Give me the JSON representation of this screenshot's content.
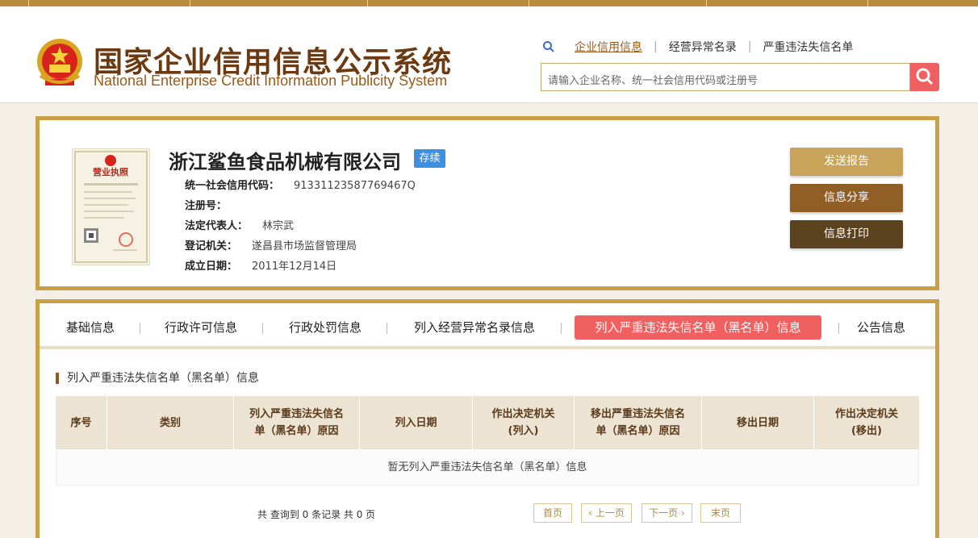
{
  "header": {
    "title_cn": "国家企业信用信息公示系统",
    "title_en": "National Enterprise Credit Information Publicity System",
    "links": [
      "企业信用信息",
      "经营异常名录",
      "严重违法失信名单"
    ],
    "search_placeholder": "请输入企业名称、统一社会信用代码或注册号",
    "icons": {
      "emblem": "national-emblem-icon",
      "magnifier": "search-icon"
    }
  },
  "company": {
    "name": "浙江鲨鱼食品机械有限公司",
    "status": "存续",
    "fields": [
      {
        "label": "统一社会信用代码：",
        "value": "91331123587769467Q"
      },
      {
        "label": "注册号：",
        "value": ""
      },
      {
        "label": "法定代表人：",
        "value": "林宗武"
      },
      {
        "label": "登记机关：",
        "value": "遂昌县市场监督管理局"
      },
      {
        "label": "成立日期：",
        "value": "2011年12月14日"
      }
    ],
    "license_title": "营业执照",
    "actions": [
      {
        "label": "发送报告",
        "color": "#c9a35a"
      },
      {
        "label": "信息分享",
        "color": "#8f5f26"
      },
      {
        "label": "信息打印",
        "color": "#5c4320"
      }
    ]
  },
  "tabs": [
    {
      "label": "基础信息",
      "active": false
    },
    {
      "label": "行政许可信息",
      "active": false
    },
    {
      "label": "行政处罚信息",
      "active": false
    },
    {
      "label": "列入经营异常名录信息",
      "active": false
    },
    {
      "label": "列入严重违法失信名单（黑名单）信息",
      "active": true
    },
    {
      "label": "公告信息",
      "active": false
    }
  ],
  "section": {
    "title": "列入严重违法失信名单（黑名单）信息",
    "columns": [
      [
        "序号"
      ],
      [
        "类别"
      ],
      [
        "列入严重违法失信名",
        "单（黑名单）原因"
      ],
      [
        "列入日期"
      ],
      [
        "作出决定机关",
        "(列入)"
      ],
      [
        "移出严重违法失信名",
        "单（黑名单）原因"
      ],
      [
        "移出日期"
      ],
      [
        "作出决定机关",
        "(移出)"
      ]
    ],
    "empty_text": "暂无列入严重违法失信名单（黑名单）信息"
  },
  "pager": {
    "summary": "共 查询到 0 条记录 共 0 页",
    "first": "首页",
    "prev": "上一页",
    "next": "下一页",
    "last": "末页"
  },
  "colors": {
    "gold_border": "#c9a045",
    "accent_red": "#f06060",
    "badge_blue": "#3f8fe0",
    "title_brown": "#6b3a12"
  }
}
